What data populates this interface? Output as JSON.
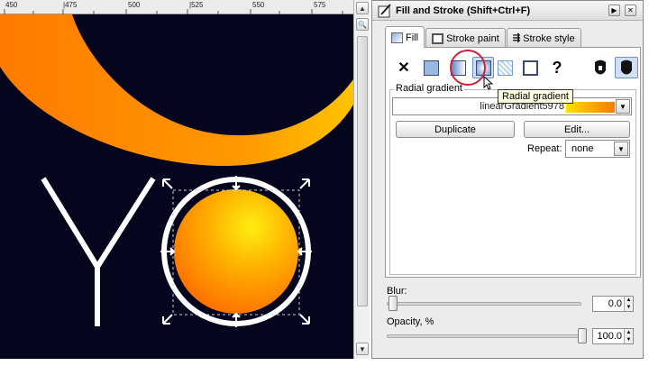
{
  "ruler": {
    "labels": [
      "450",
      "|475",
      "500",
      "|525",
      "550",
      "575"
    ]
  },
  "canvas": {
    "letters": "YO",
    "background": "#05061d"
  },
  "panel": {
    "title": "Fill and Stroke (Shift+Ctrl+F)",
    "tabs": [
      {
        "label": "Fill"
      },
      {
        "label": "Stroke paint"
      },
      {
        "label": "Stroke style"
      }
    ],
    "fill_types": [
      {
        "icon": "no-paint-icon",
        "glyph": "✕"
      },
      {
        "icon": "flat-color-icon"
      },
      {
        "icon": "linear-gradient-icon"
      },
      {
        "icon": "radial-gradient-icon"
      },
      {
        "icon": "pattern-icon"
      },
      {
        "icon": "swatch-icon"
      },
      {
        "icon": "unset-paint-icon",
        "glyph": "?"
      },
      {
        "icon": "fill-rule-evenodd-icon"
      },
      {
        "icon": "fill-rule-nonzero-icon"
      }
    ],
    "tooltip": "Radial gradient",
    "gradient": {
      "frame_label": "Radial gradient",
      "name": "linearGradient5978",
      "duplicate_label": "Duplicate",
      "edit_label": "Edit...",
      "repeat_label": "Repeat:",
      "repeat_value": "none"
    },
    "blur": {
      "label": "Blur:",
      "value": "0.0",
      "level_percent": 0
    },
    "opacity": {
      "label": "Opacity, %",
      "value": "100.0",
      "level_percent": 100
    }
  },
  "colors": {
    "accent_orange": "#ff8a00",
    "highlight_ring": "#d0203a",
    "active_fill_type": "#cfe0f5"
  }
}
